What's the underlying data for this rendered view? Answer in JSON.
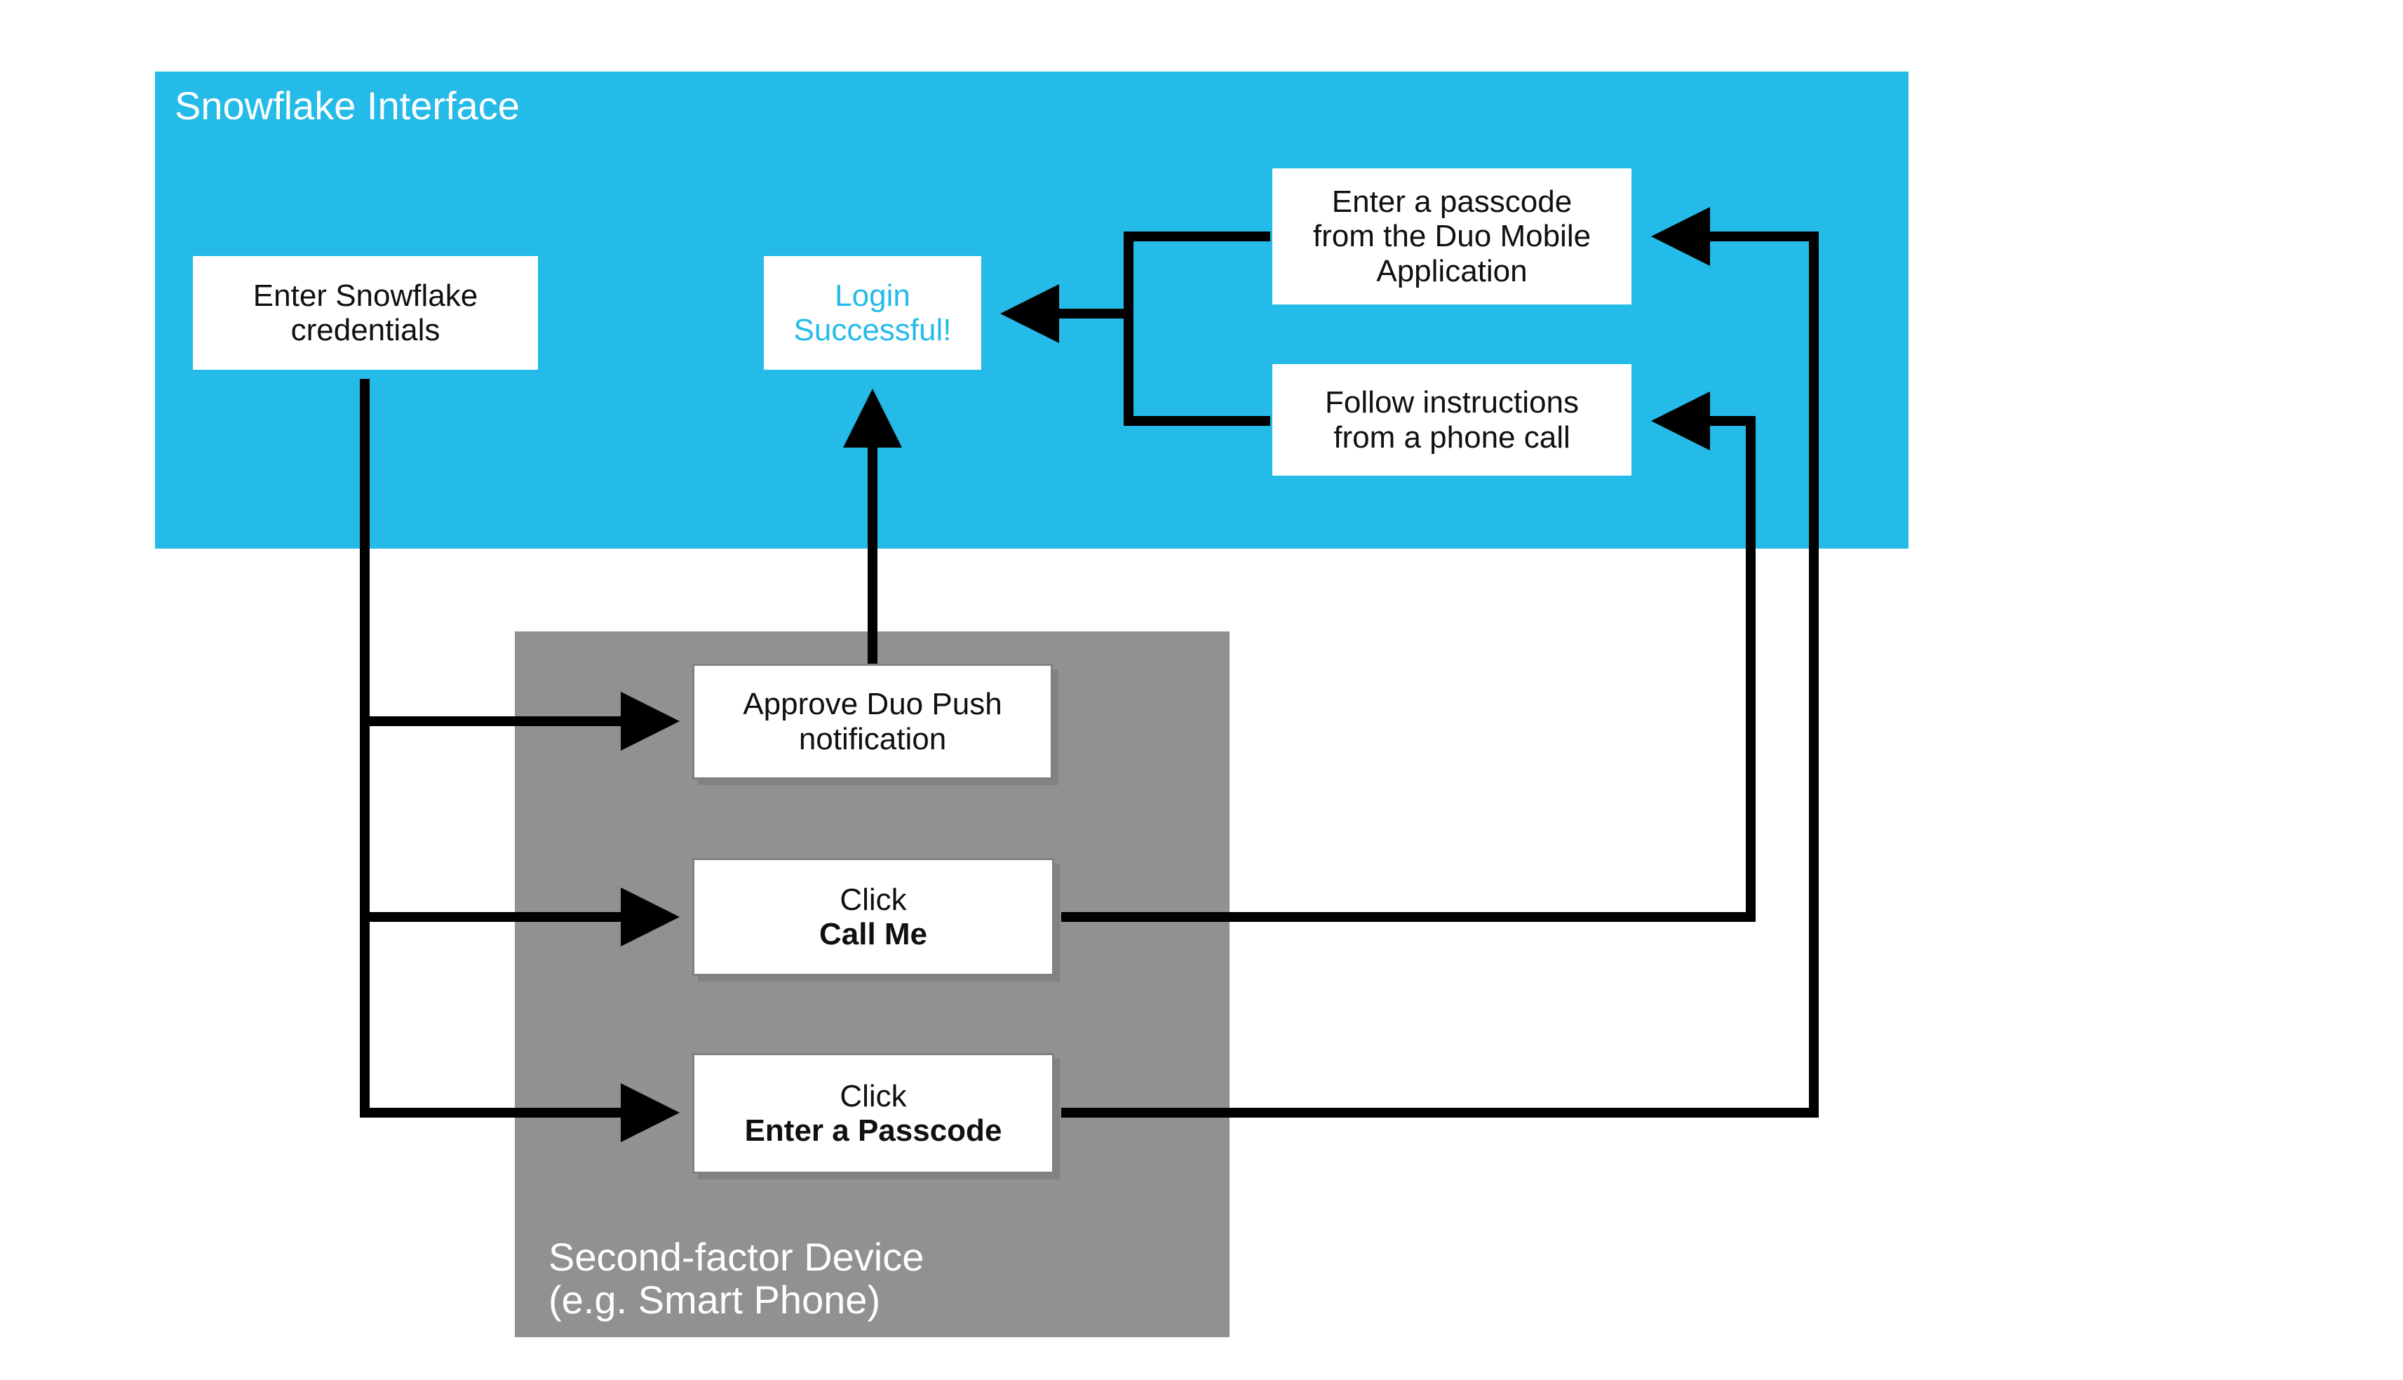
{
  "regions": {
    "snowflake": {
      "title": "Snowflake Interface"
    },
    "device": {
      "title_line1": "Second-factor Device",
      "title_line2": "(e.g. Smart Phone)"
    }
  },
  "boxes": {
    "enter_credentials": {
      "line1": "Enter Snowflake",
      "line2": "credentials"
    },
    "login_successful": {
      "line1": "Login",
      "line2": "Successful!"
    },
    "enter_passcode_duo": {
      "line1": "Enter a passcode",
      "line2": "from the Duo Mobile",
      "line3": "Application"
    },
    "follow_phone_call": {
      "line1": "Follow instructions",
      "line2": "from a phone call"
    },
    "approve_duo_push": {
      "line1": "Approve Duo Push",
      "line2": "notification"
    },
    "click_call_me": {
      "line1": "Click",
      "line2_bold": "Call Me"
    },
    "click_enter_passcode": {
      "line1": "Click",
      "line2_bold": "Enter a Passcode"
    }
  },
  "colors": {
    "region_blue": "#24bbe8",
    "region_gray": "#919191",
    "arrow_black": "#000000"
  }
}
